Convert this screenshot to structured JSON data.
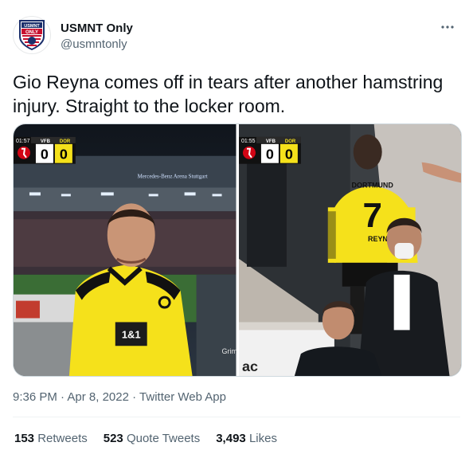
{
  "user": {
    "display_name": "USMNT Only",
    "handle": "@usmntonly",
    "avatar_text_top": "USMNT",
    "avatar_text_mid": "ONLY"
  },
  "tweet": {
    "text": "Gio Reyna comes off in tears after another hamstring injury. Straight to the locker room."
  },
  "media": {
    "left": {
      "clock": "01:57",
      "home": "VFB",
      "away": "DOR",
      "home_score": "0",
      "away_score": "0",
      "stadium_banner": "Mercedes-Benz Arena Stuttgart",
      "shirt_sponsor": "1&1",
      "board_text": "Grimm"
    },
    "right": {
      "clock": "01:55",
      "home": "VFB",
      "away": "DOR",
      "home_score": "0",
      "away_score": "0",
      "shirt_name": "DORTMUND",
      "shirt_number": "7",
      "shirt_name_lower": "REYNA",
      "board_text": "ac"
    }
  },
  "meta": {
    "time": "9:36 PM",
    "date": "Apr 8, 2022",
    "source": "Twitter Web App",
    "sep": "·"
  },
  "stats": {
    "retweets_count": "153",
    "retweets_label": "Retweets",
    "quotes_count": "523",
    "quotes_label": "Quote Tweets",
    "likes_count": "3,493",
    "likes_label": "Likes"
  },
  "colors": {
    "bvb_yellow": "#f5e11b",
    "text_primary": "#0f1419",
    "text_secondary": "#536471"
  }
}
